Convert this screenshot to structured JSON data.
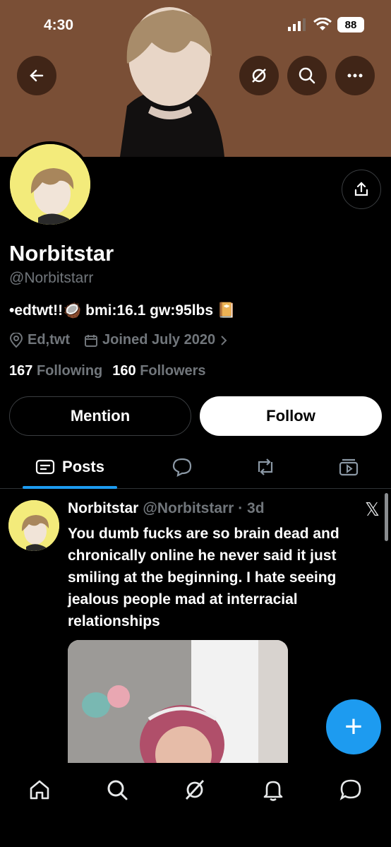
{
  "status_bar": {
    "time": "4:30",
    "battery": "88"
  },
  "profile": {
    "name": "Norbitstar",
    "handle": "@Norbitstarr",
    "bio": "•edtwt!!🥥 bmi:16.1 gw:95lbs 📔",
    "location": "Ed,twt",
    "joined": "Joined July 2020",
    "following_count": "167",
    "following_label": "Following",
    "followers_count": "160",
    "followers_label": "Followers"
  },
  "actions": {
    "mention": "Mention",
    "follow": "Follow"
  },
  "tabs": {
    "posts": "Posts"
  },
  "post": {
    "name": "Norbitstar",
    "handle_time": "@Norbitstarr · 3d",
    "text": "You dumb fucks are so brain dead and chronically online he never said it just smiling at the beginning. I hate seeing jealous people mad at interracial relationships",
    "x_logo": "𝕏"
  },
  "fab": {
    "label": "+"
  },
  "colors": {
    "accent": "#1d9bf0",
    "avatar_bg": "#f3eb7b",
    "banner": "#7a4f36"
  }
}
